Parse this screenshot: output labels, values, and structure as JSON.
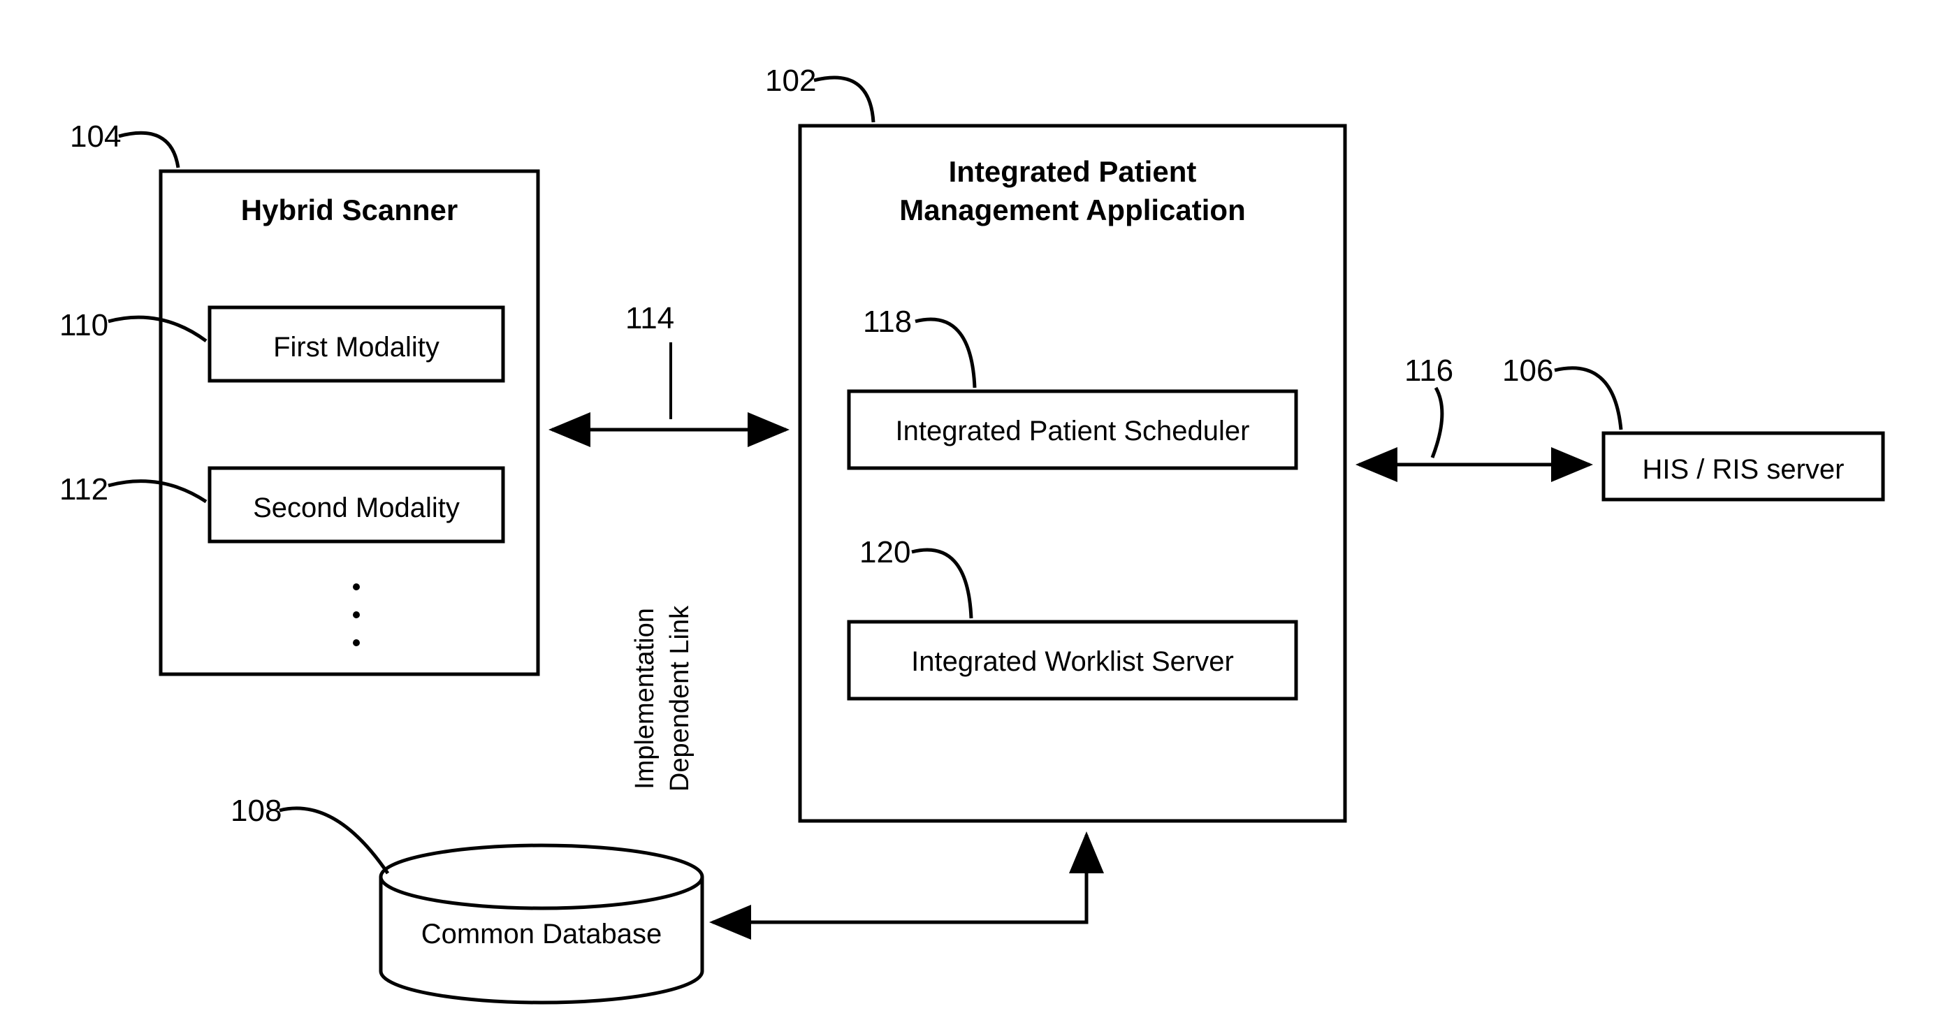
{
  "refs": {
    "app": "102",
    "scanner": "104",
    "server": "106",
    "db": "108",
    "mod1": "110",
    "mod2": "112",
    "link": "114",
    "arrow_right": "116",
    "sched": "118",
    "worklist": "120"
  },
  "scanner": {
    "title": "Hybrid Scanner",
    "mod1": "First Modality",
    "mod2": "Second Modality"
  },
  "app": {
    "title1": "Integrated Patient",
    "title2": "Management Application",
    "sched": "Integrated Patient Scheduler",
    "worklist": "Integrated Worklist Server"
  },
  "server": {
    "label": "HIS / RIS server"
  },
  "db": {
    "label": "Common Database"
  },
  "link": {
    "l1": "Implementation",
    "l2": "Dependent Link"
  }
}
